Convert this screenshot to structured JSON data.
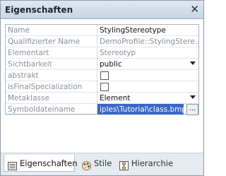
{
  "title": "Eigenschaften",
  "close_glyph": "✕",
  "properties": [
    {
      "name": "Name",
      "value": "StylingStereotype",
      "readonly": false
    },
    {
      "name": "Qualifizierter Name",
      "value": "DemoProfile::StylingStere...",
      "readonly": true
    },
    {
      "name": "Elementart",
      "value": "Stereotyp",
      "readonly": true
    },
    {
      "name": "Sichtbarkeit",
      "value": "public",
      "readonly": false
    },
    {
      "name": "abstrakt",
      "value": "",
      "readonly": false
    },
    {
      "name": "isFinalSpecialization",
      "value": "",
      "readonly": false
    },
    {
      "name": "Metaklasse",
      "value": "Element",
      "readonly": false
    },
    {
      "name": "Symboldateiname",
      "value": "iples\\Tutorial\\class.bmp",
      "readonly": false
    }
  ],
  "browse_label": "...",
  "tabs": [
    {
      "label": "Eigenschaften",
      "icon": "properties-icon",
      "active": true
    },
    {
      "label": "Stile",
      "icon": "palette-icon",
      "active": false
    },
    {
      "label": "Hierarchie",
      "icon": "hierarchy-icon",
      "active": false
    }
  ],
  "colors": {
    "selection": "#3a67c5",
    "titlebar": "#c9d5e3"
  }
}
